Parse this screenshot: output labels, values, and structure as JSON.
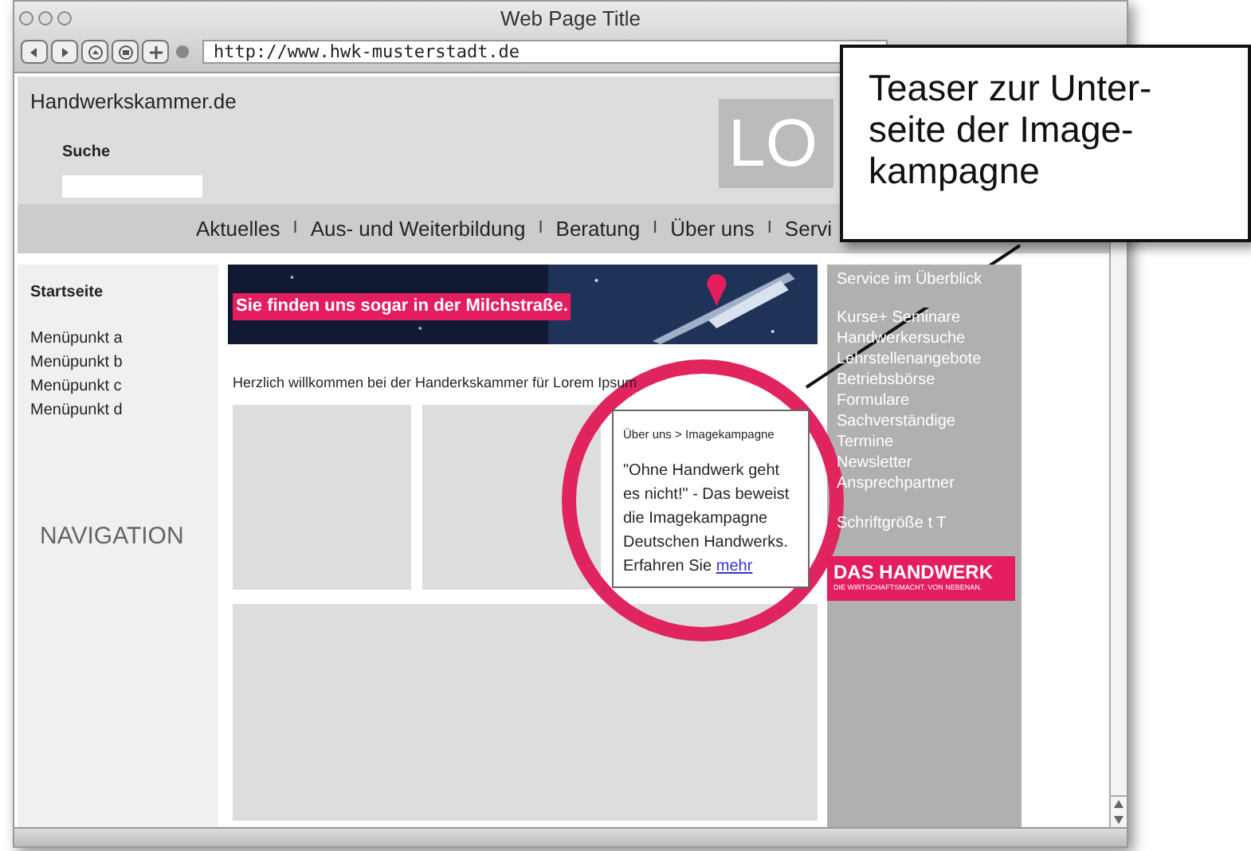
{
  "window": {
    "title": "Web Page Title",
    "url": "http://www.hwk-musterstadt.de"
  },
  "site": {
    "name": "Handwerkskammer.de",
    "search_label": "Suche",
    "logo_text": "LO"
  },
  "nav": [
    {
      "kind": "link",
      "label": "Aktuelles"
    },
    {
      "kind": "separator",
      "label": "I"
    },
    {
      "kind": "link",
      "label": "Aus- und Weiterbildung"
    },
    {
      "kind": "separator",
      "label": "I"
    },
    {
      "kind": "link",
      "label": "Beratung"
    },
    {
      "kind": "separator",
      "label": "I"
    },
    {
      "kind": "link",
      "label": "Über uns"
    },
    {
      "kind": "separator",
      "label": "I"
    },
    {
      "kind": "link",
      "label": "Servi"
    }
  ],
  "left_nav": {
    "title": "Startseite",
    "items": [
      "Menüpunkt a",
      "Menüpunkt b",
      "Menüpunkt c",
      "Menüpunkt d"
    ],
    "label": "NAVIGATION"
  },
  "banner": {
    "text": "Sie finden uns sogar in der Milchstraße."
  },
  "welcome": "Herzlich willkommen bei der Handerkskammer für Lorem Ipsum",
  "teaser": {
    "breadcrumb": "Über uns > Imagekampagne",
    "text": "\"Ohne Handwerk geht es nicht!\" - Das beweist die Imagekampagne Deutschen Handwerks. Erfahren Sie ",
    "link": "mehr"
  },
  "service": {
    "title": "Service im Überblick",
    "items": [
      "Kurse+ Seminare",
      "Handwerkersuche",
      "Lehrstellenangebote",
      "Betriebsbörse",
      "Formulare",
      "Sachverständige",
      "Termine",
      "Newsletter",
      "Ansprechpartner"
    ],
    "font_size": "Schriftgröße t T"
  },
  "brand": {
    "name": "DAS HANDWERK",
    "tagline": "DIE WIRTSCHAFTSMACHT. VON NEBENAN."
  },
  "callout": {
    "text": "Teaser zur Unter-\nseite der Image-\nkampagne"
  }
}
